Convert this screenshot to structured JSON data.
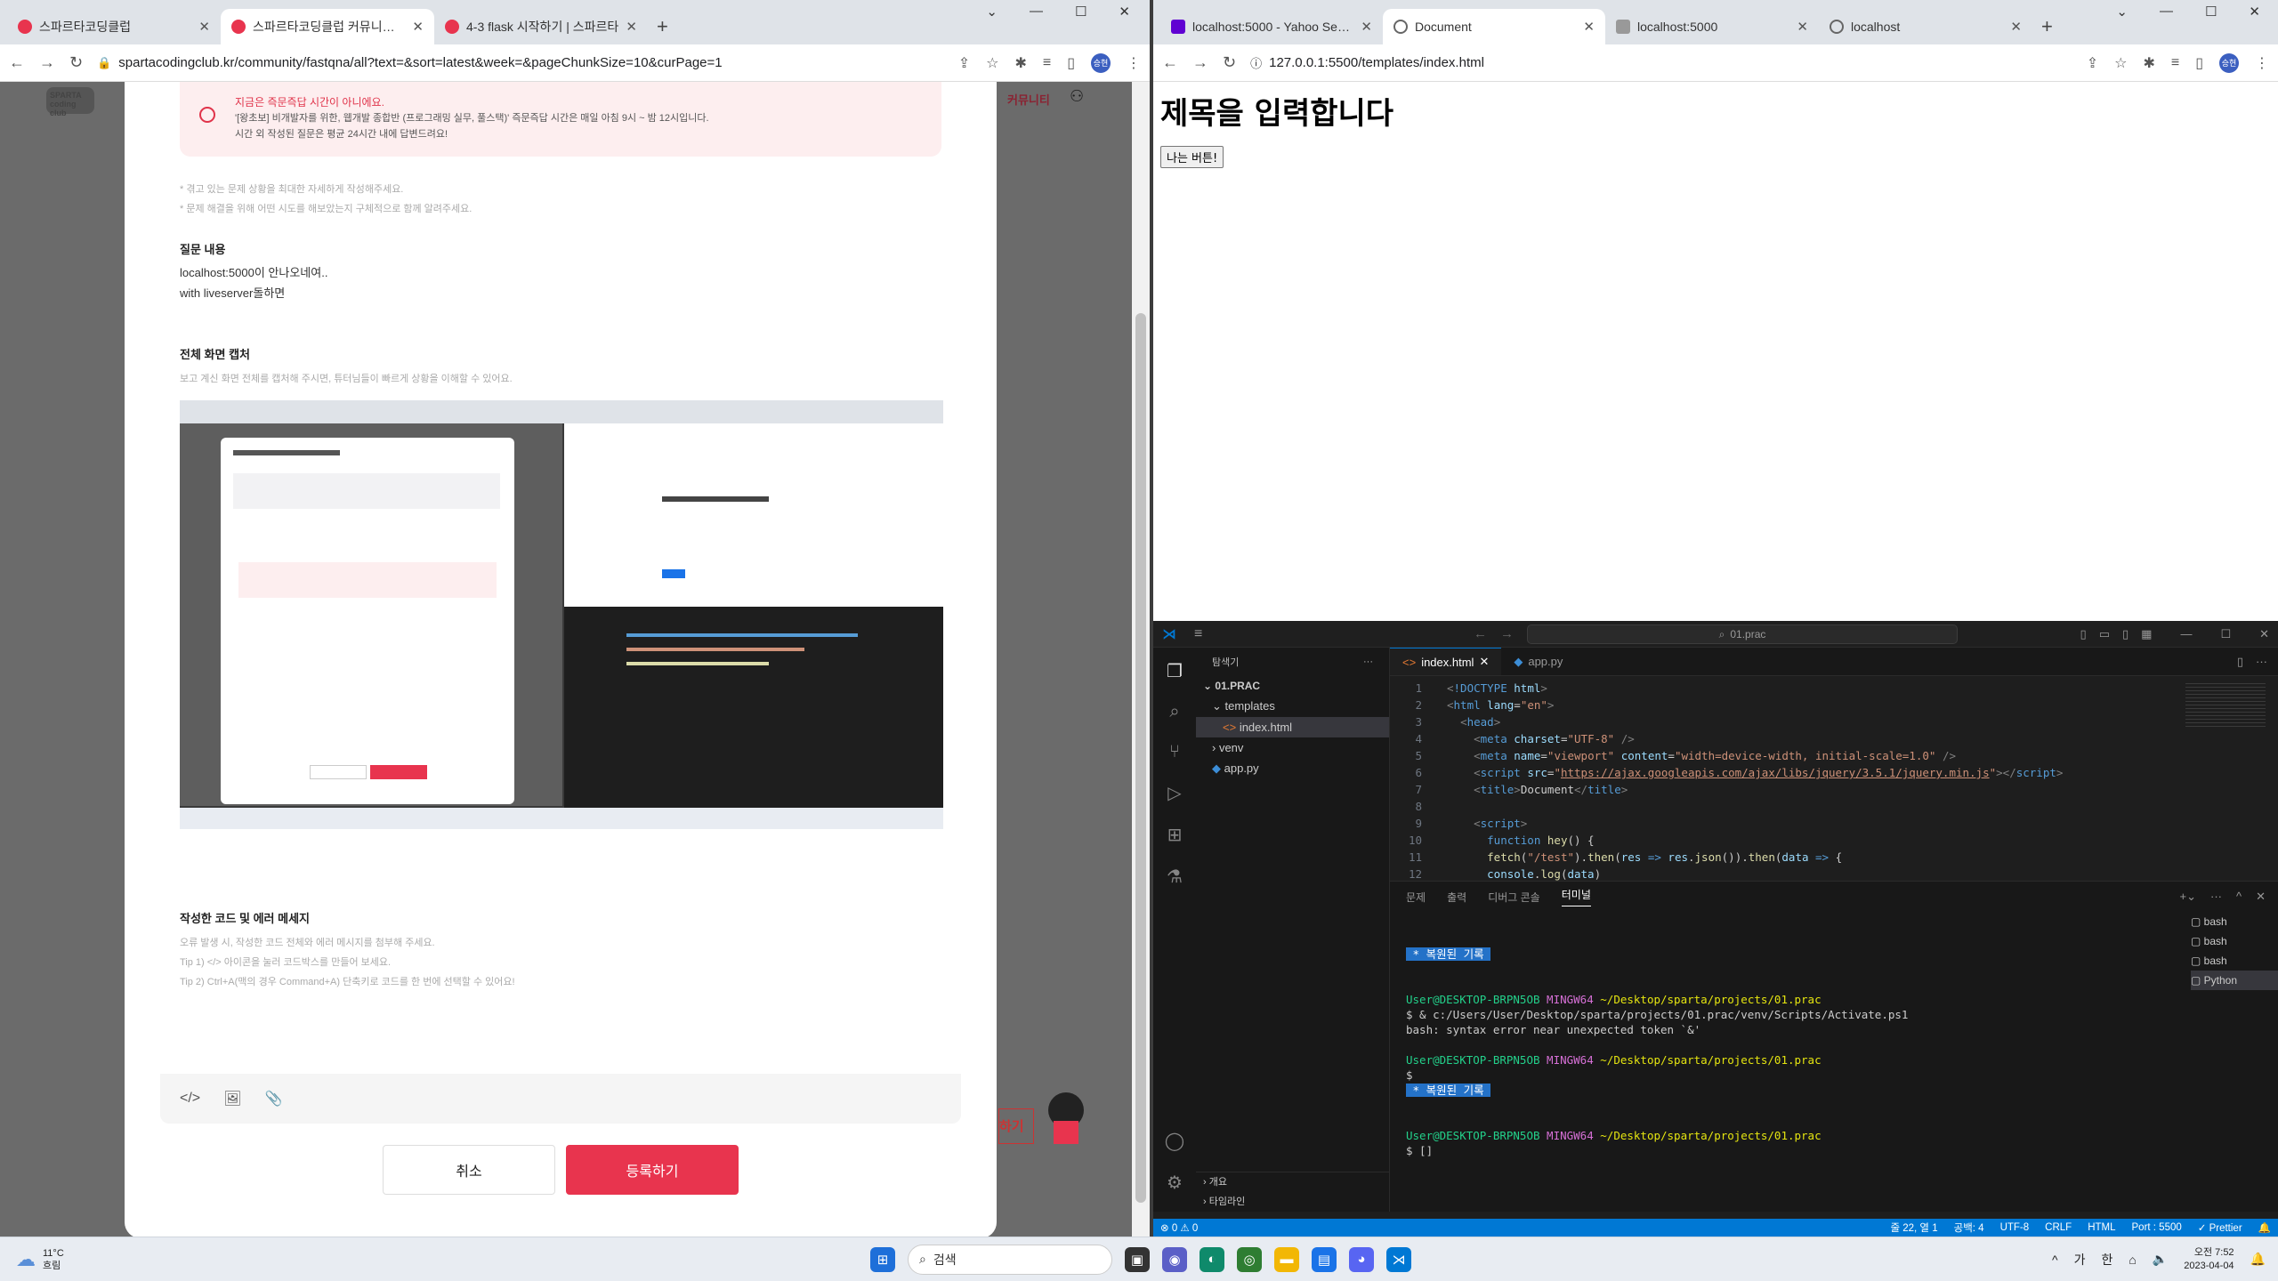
{
  "left_browser": {
    "tabs": [
      {
        "title": "스파르타코딩클럽",
        "active": false
      },
      {
        "title": "스파르타코딩클럽 커뮤니티 | 스",
        "active": true
      },
      {
        "title": "4-3 flask 시작하기 | 스파르타",
        "active": false
      }
    ],
    "url": "spartacodingclub.kr/community/fastqna/all?text=&sort=latest&week=&pageChunkSize=10&curPage=1",
    "bg_nav_item": "커뮤니티",
    "brand": "SPARTA coding club",
    "notice": {
      "title": "지금은 즉문즉답 시간이 아니에요.",
      "line1": "'[왕초보] 비개발자를 위한, 웹개발 종합반 (프로그래밍 실무, 풀스택)' 즉문즉답 시간은 매일 아침 9시 ~ 밤 12시입니다.",
      "line2": "시간 외 작성된 질문은 평균 24시간 내에 답변드려요!"
    },
    "tips": [
      "* 겪고 있는 문제 상황을 최대한 자세하게 작성해주세요.",
      "* 문제 해결을 위해 어떤 시도를 해보았는지 구체적으로 함께 알려주세요."
    ],
    "question": {
      "label": "질문 내용",
      "line1": "localhost:5000이 안나오네여..",
      "line2": "with liveserver돌하면"
    },
    "capture": {
      "label": "전체 화면 캡처",
      "hint": "보고 계신 화면 전체를 캡처해 주시면, 튜터님들이 빠르게 상황을 이해할 수 있어요."
    },
    "code_section": {
      "label": "작성한 코드 및 에러 메세지",
      "hint1": "오류 발생 시, 작성한 코드 전체와 에러 메시지를 첨부해 주세요.",
      "hint2": "Tip 1) </> 아이콘을 눌러 코드박스를 만들어 보세요.",
      "hint3": "Tip 2) Ctrl+A(맥의 경우 Command+A) 단축키로 코드를 한 번에 선택할 수 있어요!"
    },
    "editor_icons": [
      "code-icon",
      "image-icon",
      "attach-icon"
    ],
    "cancel_label": "취소",
    "submit_label": "등록하기",
    "bg_submit": "하기"
  },
  "right_browser": {
    "tabs": [
      {
        "title": "localhost:5000 - Yahoo Search R",
        "active": false
      },
      {
        "title": "Document",
        "active": true
      },
      {
        "title": "localhost:5000",
        "active": false
      },
      {
        "title": "localhost",
        "active": false
      }
    ],
    "url": "127.0.0.1:5500/templates/index.html",
    "heading": "제목을 입력합니다",
    "button_label": "나는 버튼!"
  },
  "vscode": {
    "search": "01.prac",
    "explorer_title": "탐색기",
    "project": "01.PRAC",
    "tree": [
      {
        "name": "templates",
        "indent": 1,
        "type": "folder-open"
      },
      {
        "name": "index.html",
        "indent": 2,
        "type": "html"
      },
      {
        "name": "venv",
        "indent": 1,
        "type": "folder"
      },
      {
        "name": "app.py",
        "indent": 1,
        "type": "py"
      }
    ],
    "outline": "개요",
    "timeline": "타임라인",
    "tabs": [
      {
        "name": "index.html",
        "active": true
      },
      {
        "name": "app.py",
        "active": false
      }
    ],
    "panel_tabs": [
      "문제",
      "출력",
      "디버그 콘솔",
      "터미널"
    ],
    "terminal_list": [
      "bash",
      "bash",
      "bash",
      "Python"
    ],
    "terminal": {
      "history": " * 복원된 기록 ",
      "user": "User@DESKTOP-BRPN5OB",
      "shell": "MINGW64",
      "path": "~/Desktop/sparta/projects/01.prac",
      "cmd": "$ & c:/Users/User/Desktop/sparta/projects/01.prac/venv/Scripts/Activate.ps1",
      "error": "bash: syntax error near unexpected token `&'",
      "prompt1": "$",
      "prompt2": "$ []"
    },
    "status": {
      "errors": "⊗ 0 ⚠ 0",
      "position": "줄 22, 열 1",
      "spaces": "공백: 4",
      "encoding": "UTF-8",
      "eol": "CRLF",
      "lang": "HTML",
      "port": "Port : 5500",
      "prettier": "✓ Prettier"
    }
  },
  "taskbar": {
    "weather_temp": "11°C",
    "weather_text": "흐림",
    "search_label": "검색",
    "ime1": "가",
    "ime2": "한",
    "time": "오전 7:52",
    "date": "2023-04-04"
  }
}
